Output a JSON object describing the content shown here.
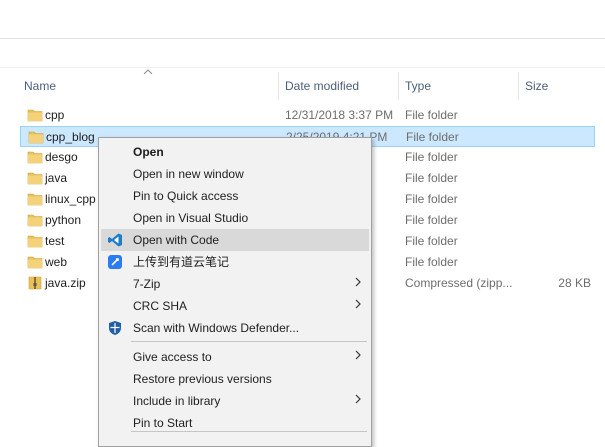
{
  "columns": {
    "name": "Name",
    "date": "Date modified",
    "type": "Type",
    "size": "Size"
  },
  "files": [
    {
      "name": "cpp",
      "date": "12/31/2018 3:37 PM",
      "type": "File folder",
      "size": "",
      "icon": "folder-icon"
    },
    {
      "name": "cpp_blog",
      "date": "2/25/2019 4:21 PM",
      "type": "File folder",
      "size": "",
      "icon": "folder-icon"
    },
    {
      "name": "desgo",
      "date": "PM",
      "type": "File folder",
      "size": "",
      "icon": "folder-icon"
    },
    {
      "name": "java",
      "date": "PM",
      "type": "File folder",
      "size": "",
      "icon": "folder-icon"
    },
    {
      "name": "linux_cpp",
      "date": "PM",
      "type": "File folder",
      "size": "",
      "icon": "folder-icon"
    },
    {
      "name": "python",
      "date": "PM",
      "type": "File folder",
      "size": "",
      "icon": "folder-icon"
    },
    {
      "name": "test",
      "date": "PM",
      "type": "File folder",
      "size": "",
      "icon": "folder-icon"
    },
    {
      "name": "web",
      "date": "PM",
      "type": "File folder",
      "size": "",
      "icon": "folder-icon"
    },
    {
      "name": "java.zip",
      "date": "PM",
      "type": "Compressed (zipp...",
      "size": "28 KB",
      "icon": "zip-file-icon"
    }
  ],
  "context_menu": {
    "items": [
      {
        "label": "Open",
        "bold": true
      },
      {
        "label": "Open in new window"
      },
      {
        "label": "Pin to Quick access"
      },
      {
        "label": "Open in Visual Studio"
      },
      {
        "label": "Open with Code",
        "icon": "vscode-icon",
        "hover": true
      },
      {
        "label": "上传到有道云笔记",
        "icon": "youdao-note-icon"
      },
      {
        "label": "7-Zip",
        "submenu": true
      },
      {
        "label": "CRC SHA",
        "submenu": true
      },
      {
        "label": "Scan with Windows Defender...",
        "icon": "windows-defender-icon"
      },
      {
        "label": "Give access to",
        "submenu": true
      },
      {
        "label": "Restore previous versions"
      },
      {
        "label": "Include in library",
        "submenu": true
      },
      {
        "label": "Pin to Start"
      }
    ]
  },
  "colors": {
    "selection": "#cce8ff",
    "selection_border": "#99d1ff",
    "header_text": "#4c607a",
    "folder": "#e8c15a",
    "vscode": "#1f7cc9",
    "youdao": "#2b7cf2",
    "defender": "#1f5fa8"
  }
}
